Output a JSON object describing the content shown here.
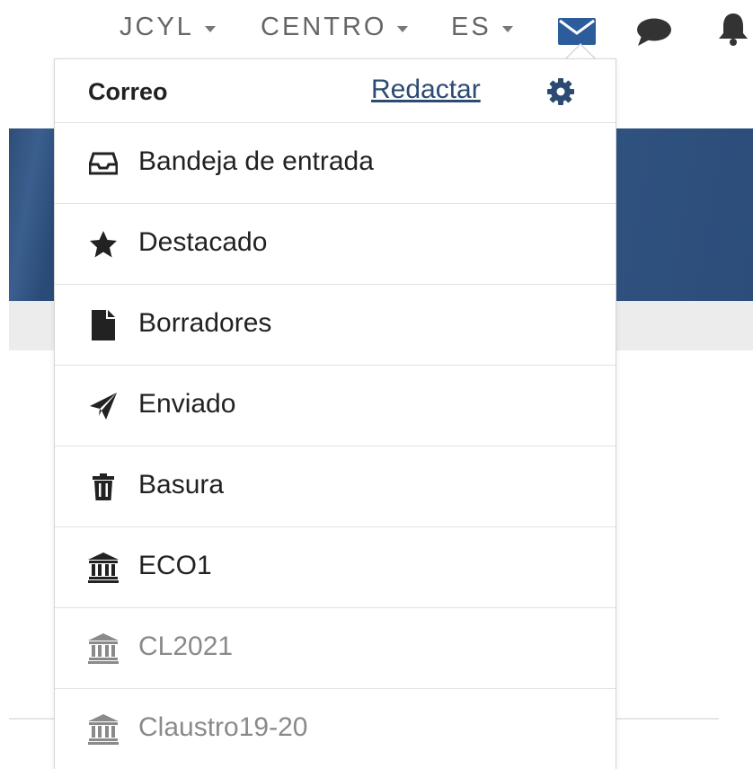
{
  "nav": {
    "menus": [
      {
        "label": "JCYL"
      },
      {
        "label": "CENTRO"
      },
      {
        "label": "ES"
      }
    ],
    "icons": [
      "envelope-icon",
      "chat-bubble-icon",
      "bell-icon"
    ],
    "accent_color": "#2c4a72"
  },
  "mail_menu": {
    "title": "Correo",
    "compose_label": "Redactar",
    "settings_icon": "gear-icon",
    "items": [
      {
        "label": "Bandeja de entrada",
        "icon": "inbox-icon"
      },
      {
        "label": "Destacado",
        "icon": "star-icon"
      },
      {
        "label": "Borradores",
        "icon": "document-icon"
      },
      {
        "label": "Enviado",
        "icon": "paper-plane-icon"
      },
      {
        "label": "Basura",
        "icon": "trash-icon"
      },
      {
        "label": "ECO1",
        "icon": "institution-icon"
      },
      {
        "label": "CL2021",
        "icon": "institution-icon"
      },
      {
        "label": "Claustro19-20",
        "icon": "institution-icon"
      }
    ]
  }
}
